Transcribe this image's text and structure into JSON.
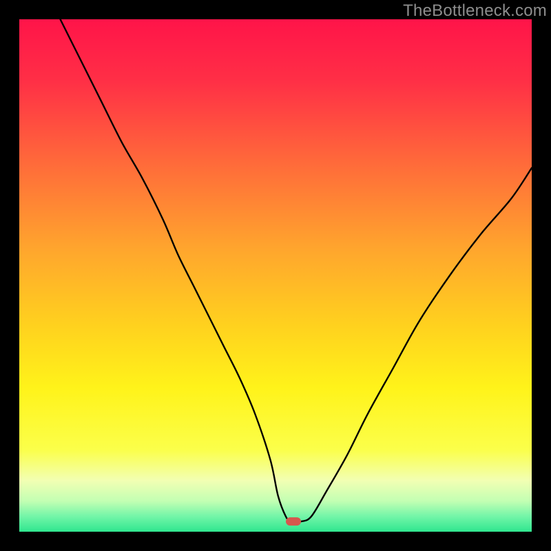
{
  "watermark": "TheBottleneck.com",
  "chart_data": {
    "type": "line",
    "title": "",
    "xlabel": "",
    "ylabel": "",
    "xlim": [
      0,
      100
    ],
    "ylim": [
      0,
      100
    ],
    "grid": false,
    "legend": false,
    "marker": {
      "name": "optimal-point",
      "color": "#d6574e",
      "x": 53.5,
      "y": 2
    },
    "series": [
      {
        "name": "bottleneck-curve",
        "color": "#000000",
        "x": [
          8,
          12,
          16,
          20,
          24,
          28,
          31,
          34,
          37,
          40,
          43,
          46,
          49,
          50.5,
          52,
          53,
          55,
          57,
          60,
          64,
          68,
          73,
          78,
          84,
          90,
          96,
          100
        ],
        "y": [
          100,
          92,
          84,
          76,
          69,
          61,
          54,
          48,
          42,
          36,
          30,
          23,
          14,
          7,
          3,
          2,
          2,
          3,
          8,
          15,
          23,
          32,
          41,
          50,
          58,
          65,
          71
        ]
      }
    ],
    "background_gradient": {
      "stops": [
        {
          "offset": 0.0,
          "color": "#ff1449"
        },
        {
          "offset": 0.12,
          "color": "#ff2f46"
        },
        {
          "offset": 0.28,
          "color": "#ff6a3a"
        },
        {
          "offset": 0.45,
          "color": "#ffa62d"
        },
        {
          "offset": 0.6,
          "color": "#ffd21e"
        },
        {
          "offset": 0.72,
          "color": "#fff31a"
        },
        {
          "offset": 0.84,
          "color": "#fbff4a"
        },
        {
          "offset": 0.9,
          "color": "#f2ffb3"
        },
        {
          "offset": 0.94,
          "color": "#c3ffb3"
        },
        {
          "offset": 0.97,
          "color": "#73f5a8"
        },
        {
          "offset": 1.0,
          "color": "#2fe68f"
        }
      ]
    }
  }
}
